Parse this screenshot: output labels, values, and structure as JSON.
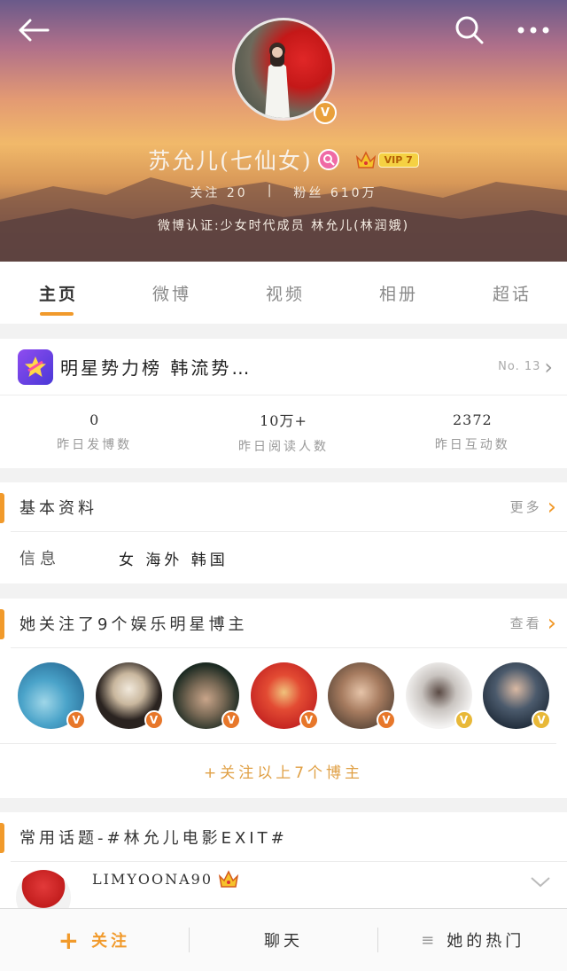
{
  "header": {
    "user_name": "苏允儿(七仙女)",
    "vip_label": "VIP 7",
    "follow_stat": "关注 20",
    "fans_stat": "粉丝 610万",
    "stat_separator": "|",
    "verification": "微博认证:少女时代成员 林允儿(林润娥)"
  },
  "tabs": [
    {
      "label": "主页",
      "active": true
    },
    {
      "label": "微博",
      "active": false
    },
    {
      "label": "视频",
      "active": false
    },
    {
      "label": "相册",
      "active": false
    },
    {
      "label": "超话",
      "active": false
    }
  ],
  "rank": {
    "title": "明星势力榜 韩流势…",
    "rank_no": "No. 13",
    "stats": [
      {
        "value": "0",
        "label": "昨日发博数"
      },
      {
        "value": "10万+",
        "label": "昨日阅读人数"
      },
      {
        "value": "2372",
        "label": "昨日互动数"
      }
    ]
  },
  "basic_info": {
    "title": "基本资料",
    "more_label": "更多",
    "info_label": "信息",
    "info_value": "女  海外 韩国"
  },
  "following": {
    "title": "她关注了9个娱乐明星博主",
    "view_label": "查看",
    "follow_all_label": "+关注以上7个博主",
    "avatars": [
      {
        "name": "followed-user-1",
        "badge": "V",
        "badge_color": "#e7772a"
      },
      {
        "name": "followed-user-2",
        "badge": "V",
        "badge_color": "#e7772a"
      },
      {
        "name": "followed-user-3",
        "badge": "V",
        "badge_color": "#e7772a"
      },
      {
        "name": "followed-user-4",
        "badge": "V",
        "badge_color": "#e7772a"
      },
      {
        "name": "followed-user-5",
        "badge": "V",
        "badge_color": "#e7772a"
      },
      {
        "name": "followed-user-6",
        "badge": "V",
        "badge_color": "#e8b838"
      },
      {
        "name": "followed-user-7",
        "badge": "V",
        "badge_color": "#e8b838"
      }
    ]
  },
  "topics": {
    "title": "常用话题-#林允儿电影EXIT#",
    "username": "LIMYOONA90"
  },
  "bottom_bar": {
    "follow_label": "关注",
    "chat_label": "聊天",
    "hot_label": "她的热门"
  },
  "colors": {
    "accent": "#f19a2b",
    "vip_bg": "#f5d143",
    "gender": "#ef6aa5"
  },
  "icons": {
    "back": "back-arrow-icon",
    "search": "search-icon",
    "more": "more-dots-icon",
    "verified": "verified-v-icon",
    "gender": "female-icon",
    "crown": "crown-icon",
    "rank": "star-rank-icon",
    "chevron": "chevron-right-icon",
    "plus": "plus-icon",
    "menu": "menu-lines-icon"
  },
  "avatar_badge": "V"
}
